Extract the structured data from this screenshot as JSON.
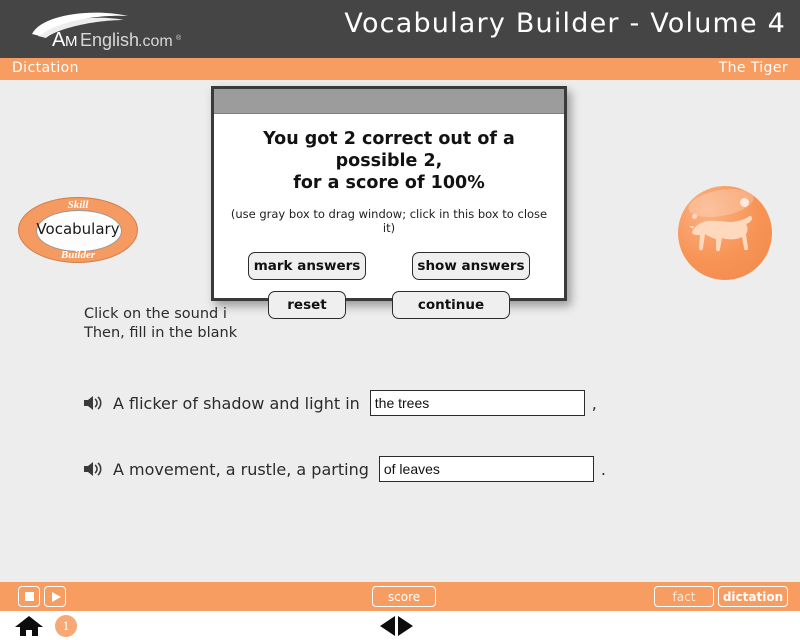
{
  "header": {
    "logo_text": "AmEnglish.com",
    "logo_mark": "swoosh-logo",
    "app_title": "Vocabulary Builder - Volume 4",
    "background_color": "#454545"
  },
  "subbar": {
    "left_label": "Dictation",
    "right_label": "The Tiger",
    "background_color": "#f89d62"
  },
  "skill_badge": {
    "top_label": "Skill",
    "center_label": "Vocabulary",
    "bottom_label": "Builder",
    "color": "#f59a60"
  },
  "tiger_badge": {
    "icon_name": "tiger-silhouette-icon",
    "color": "#f79355"
  },
  "instructions": {
    "text": "Click on the sound i\nThen, fill in the blank"
  },
  "exercise": {
    "rows": [
      {
        "speaker_icon": "speaker-icon",
        "sentence": "A flicker of shadow and light in",
        "answer_value": "the trees",
        "answer_placeholder": "",
        "punctuation": ","
      },
      {
        "speaker_icon": "speaker-icon",
        "sentence": "A movement, a rustle, a parting",
        "answer_value": "of leaves",
        "answer_placeholder": "",
        "punctuation": "."
      }
    ]
  },
  "dialog": {
    "heading": "You got 2 correct out of a possible 2,\nfor a score of 100%",
    "note": "(use gray box to drag window; click in this box to close it)",
    "buttons": {
      "mark_answers": "mark answers",
      "show_answers": "show answers",
      "reset": "reset",
      "continue": "continue"
    },
    "titlebar_color": "#9c9c9c"
  },
  "toolbar": {
    "stop_icon": "stop-icon",
    "play_icon": "play-icon",
    "score_label": "score",
    "fact_label": "fact",
    "dictation_label": "dictation",
    "background_color": "#f89d62"
  },
  "footer": {
    "home_icon": "home-icon",
    "page_number": "1",
    "prev_icon": "arrow-left-icon",
    "next_icon": "arrow-right-icon"
  }
}
